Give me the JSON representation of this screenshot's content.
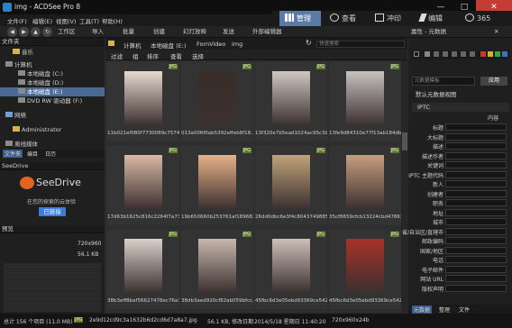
{
  "window": {
    "title": "img - ACDSee Pro 8",
    "app_number": "8"
  },
  "menu": [
    "文件(F)",
    "编辑(E)",
    "视图(V)",
    "工具(T)",
    "帮助(H)"
  ],
  "modes": [
    {
      "label": "管理",
      "active": true
    },
    {
      "label": "查看",
      "active": false
    },
    {
      "label": "冲印",
      "active": false
    },
    {
      "label": "编辑",
      "active": false
    },
    {
      "label": "365",
      "active": false
    }
  ],
  "toolbar": {
    "items": [
      "工作区",
      "导入",
      "批量",
      "创建",
      "幻灯放映",
      "发送",
      "外部编辑器"
    ],
    "properties_tab": "属性 - 元数据"
  },
  "left_panel": {
    "folders_head": "文件夹",
    "tree": [
      {
        "label": "音乐",
        "indent": 1,
        "kind": "folder"
      },
      {
        "label": "计算机",
        "indent": 0,
        "kind": "drive"
      },
      {
        "label": "本地磁盘 (C:)",
        "indent": 1,
        "kind": "drive"
      },
      {
        "label": "本地磁盘 (D:)",
        "indent": 1,
        "kind": "drive"
      },
      {
        "label": "本地磁盘 (E:)",
        "indent": 1,
        "kind": "drive",
        "selected": true
      },
      {
        "label": "DVD RW 驱动器 (F:)",
        "indent": 1,
        "kind": "drive"
      },
      {
        "label": "网络",
        "indent": 0,
        "kind": "folder"
      },
      {
        "label": "Administrator",
        "indent": 1,
        "kind": "folder"
      },
      {
        "label": "离线媒体",
        "indent": 0,
        "kind": "folder"
      }
    ],
    "tabs": [
      "文件夹",
      "编目",
      "日历"
    ],
    "seedrive_head": "SeeDrive",
    "seedrive_brand": "SeeDrive",
    "seedrive_caption": "在您的探索的云体验",
    "seedrive_button": "已链接",
    "preview_head": "预览",
    "preview_size": "720x960",
    "preview_filesize": "56.1 KB"
  },
  "path": {
    "crumbs": [
      "计算机",
      "本地磁盘 (E:)",
      "FornVideo",
      "img"
    ],
    "search_placeholder": "快速搜索"
  },
  "filter": [
    "过滤",
    "组",
    "排序",
    "查看",
    "选择"
  ],
  "thumbnails": [
    {
      "caption": "11b021ef080f7730089c75740...",
      "badge": "JPG",
      "color": "#e8d9cf"
    },
    {
      "caption": "013a006f0ab5392effeb8f18...",
      "badge": "JPG",
      "color": "#3a2e2a"
    },
    {
      "caption": "13f320e7b5ead1024ac95c3b2...",
      "badge": "JPG",
      "color": "#cfc7c0"
    },
    {
      "caption": "13fe9d84310e77f13ab184db...",
      "badge": "JPG",
      "color": "#c8c2bf"
    },
    {
      "caption": "17d63b1625c816c2264f7a73e...",
      "badge": "JPG",
      "color": "#d9b9a6"
    },
    {
      "caption": "19b650660b253761af189682e...",
      "badge": "JPG",
      "color": "#e7b188"
    },
    {
      "caption": "26dd0dbc6e3f4c8043749885...",
      "badge": "JPG",
      "color": "#bfa37a"
    },
    {
      "caption": "35cf8659cfcb13224cbd47863...",
      "badge": "JPG",
      "color": "#c89e7e"
    },
    {
      "caption": "38b3eff8baf56627478ec76a7...",
      "badge": "JPG",
      "color": "#d8d1c9"
    },
    {
      "caption": "38db3aed920cf82ab059bfcc...",
      "badge": "JPG",
      "color": "#c7b8ae"
    },
    {
      "caption": "45fbc6d3e05ebd93369ce542...",
      "badge": "JPG",
      "color": "#cdbfb7"
    },
    {
      "caption": "45fbc6d3e05ebd93369ce542...",
      "badge": "JPG",
      "color": "#a8322a"
    }
  ],
  "right_panel": {
    "preset_placeholder": "元数据模板",
    "apply_button": "应用",
    "view_select": "默认元数据视图",
    "section": "IPTC",
    "content_head": "内容",
    "fields": [
      "标题",
      "大标题",
      "描述",
      "描述作者",
      "关键词",
      "IPTC 主题代码",
      "新人",
      "创建者",
      "职务",
      "地址",
      "城市",
      "省/自治区/直辖市",
      "邮政编码",
      "国家/地区",
      "电话",
      "电子邮件",
      "网站 URL",
      "版权声明"
    ],
    "tabs": [
      "元数据",
      "整理",
      "文件"
    ]
  },
  "status": {
    "total": "总计 156 个项目 (11.0 MB)",
    "badge": "JPG",
    "filename": "2e9d12cd9c3a1632b6d2cd6d7a8a7.jpg",
    "filesize": "56.1 KB, 修改日期",
    "datetime": "2014/5/18 星期日 11:40:20",
    "dimensions": "720x960x24b"
  }
}
